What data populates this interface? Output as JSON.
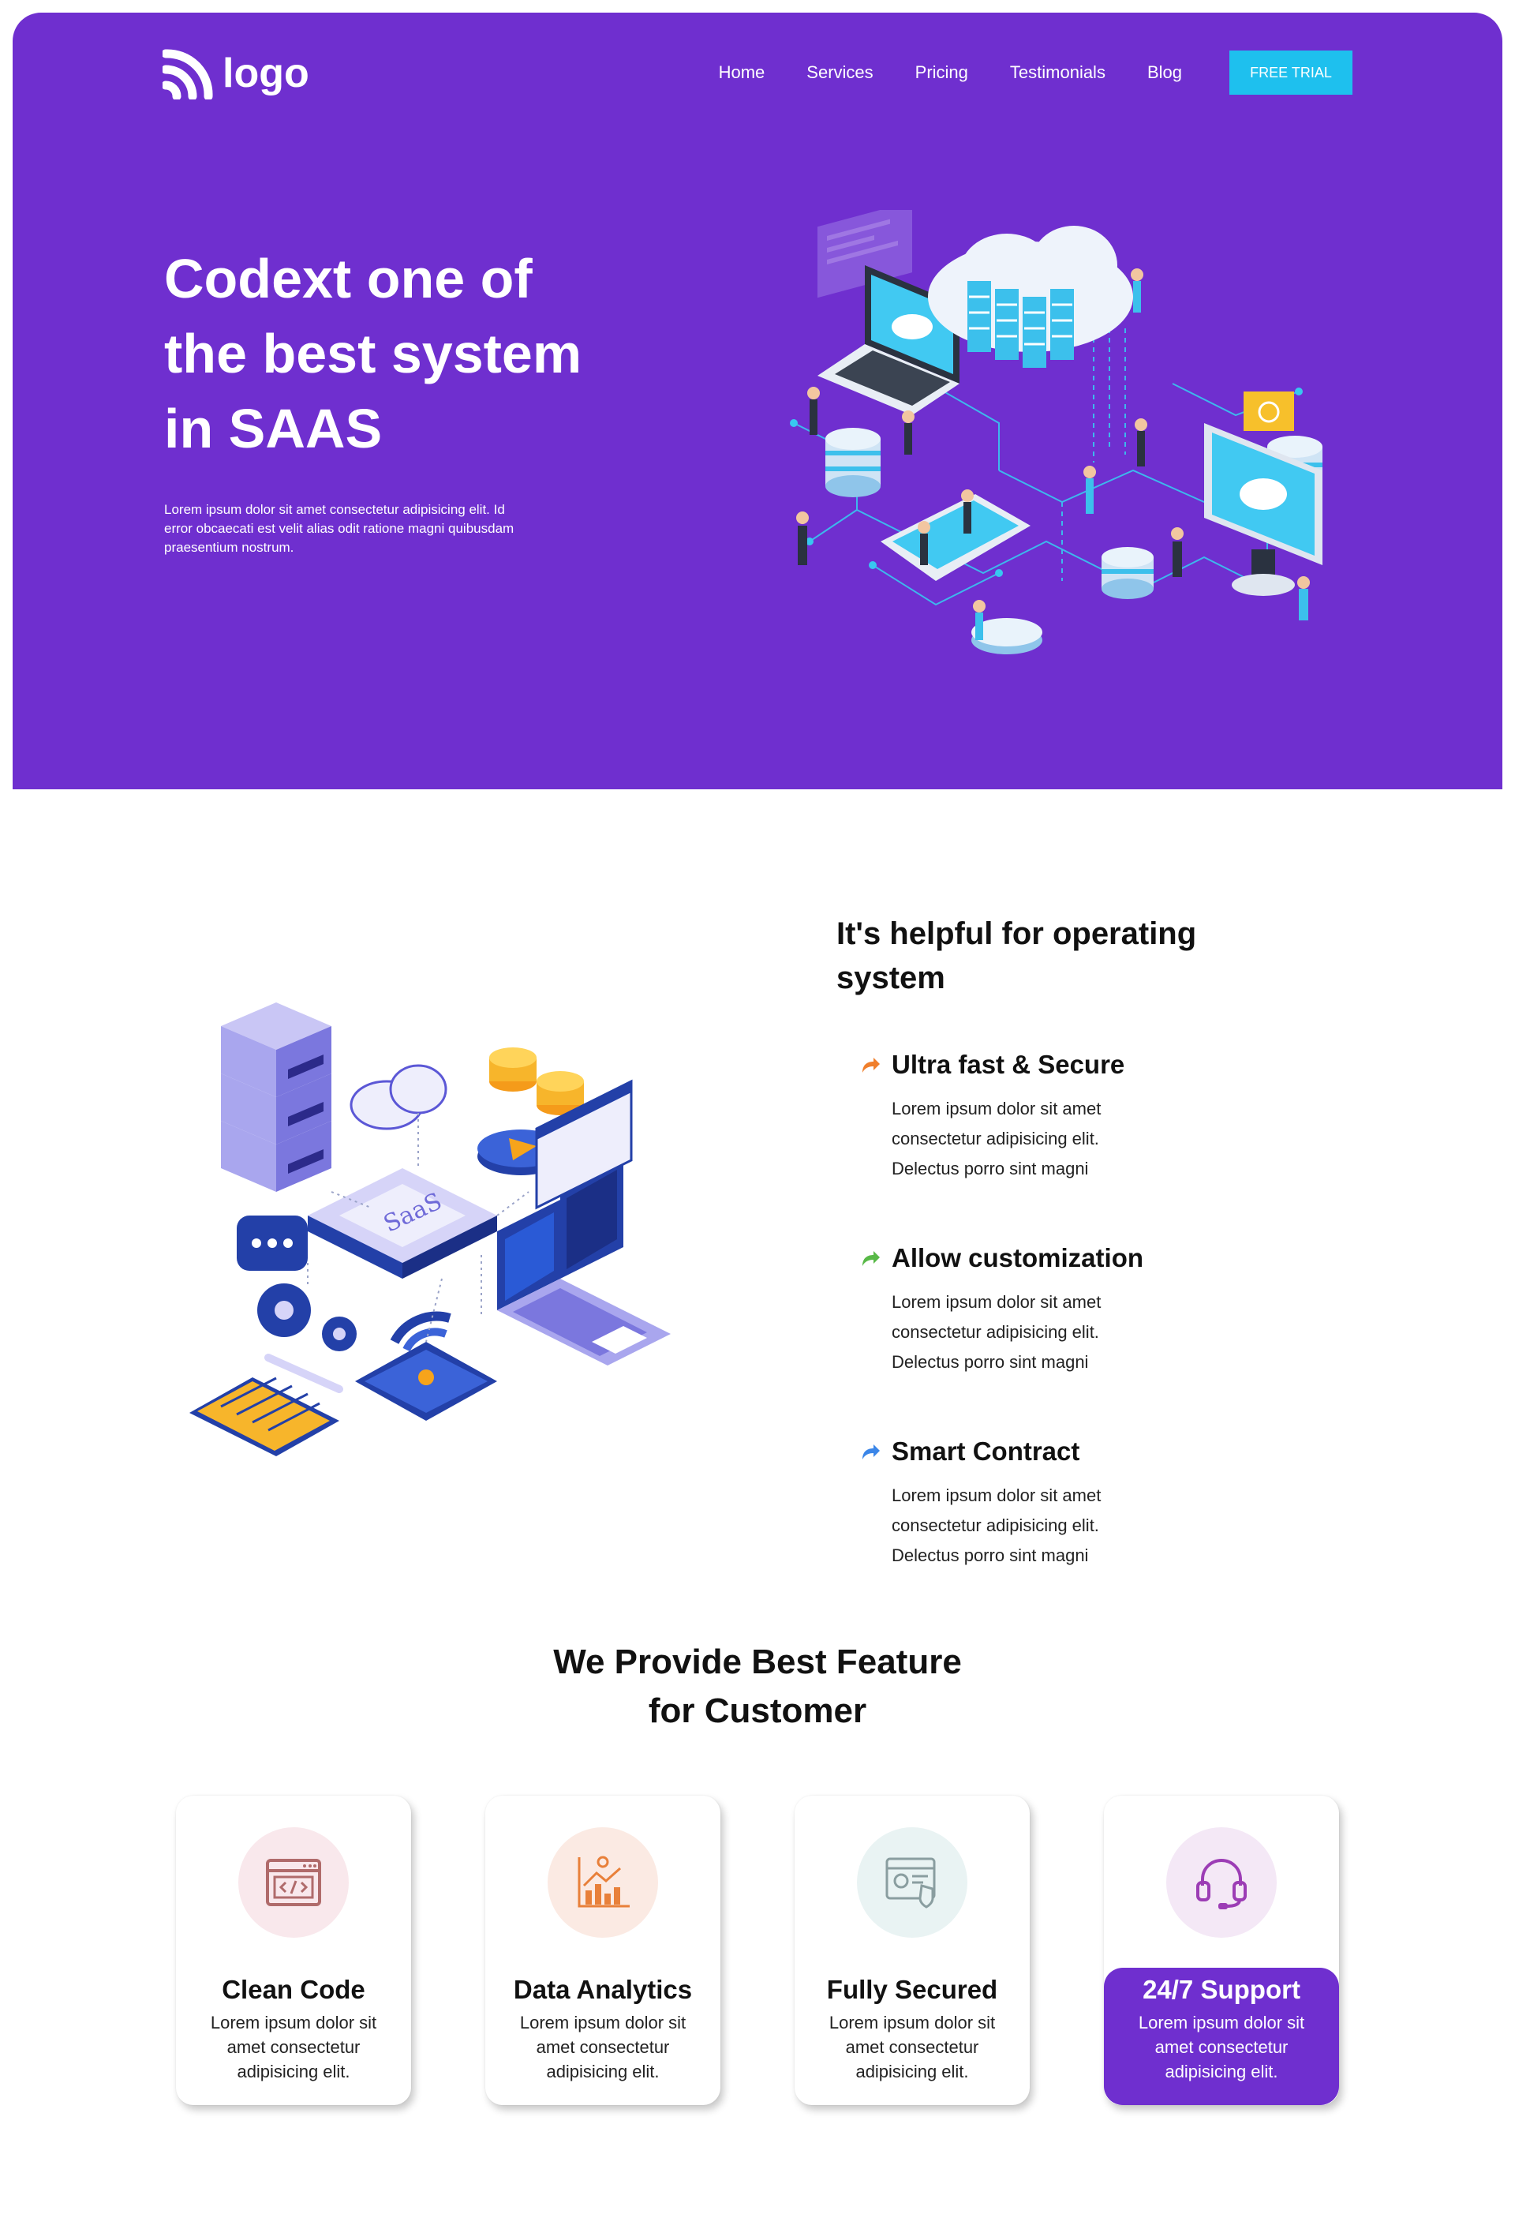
{
  "nav": {
    "logo_text": "logo",
    "items": [
      "Home",
      "Services",
      "Pricing",
      "Testimonials",
      "Blog"
    ],
    "cta": "FREE TRIAL"
  },
  "hero": {
    "title_line1": "Codext one of",
    "title_line2": "the best system",
    "title_line3": "in SAAS",
    "text": "Lorem ipsum dolor sit amet consectetur adipisicing elit. Id error obcaecati est velit alias odit ratione magni quibusdam praesentium nostrum."
  },
  "section2": {
    "title": "It's helpful for operating system",
    "illustration_label": "SaaS",
    "features": [
      {
        "title": "Ultra fast & Secure",
        "text": "Lorem ipsum dolor sit amet consectetur adipisicing elit. Delectus porro sint magni",
        "arrow_color": "#f07f2c"
      },
      {
        "title": "Allow customization",
        "text": "Lorem ipsum dolor sit amet consectetur adipisicing elit. Delectus porro sint magni",
        "arrow_color": "#58b947"
      },
      {
        "title": "Smart Contract",
        "text": "Lorem ipsum dolor sit amet consectetur adipisicing elit. Delectus porro sint magni",
        "arrow_color": "#3b86e8"
      }
    ]
  },
  "section3": {
    "title_line1": "We Provide Best Feature",
    "title_line2": "for Customer",
    "cards": [
      {
        "title": "Clean Code",
        "text": "Lorem ipsum dolor sit amet consectetur adipisicing elit.",
        "icon": "code-window-icon",
        "bg": "#f9e8ec",
        "color": "#b06b6b"
      },
      {
        "title": "Data Analytics",
        "text": "Lorem ipsum dolor sit amet consectetur adipisicing elit.",
        "icon": "analytics-chart-icon",
        "bg": "#fbeae3",
        "color": "#e8803a"
      },
      {
        "title": "Fully Secured",
        "text": "Lorem ipsum dolor sit amet consectetur adipisicing elit.",
        "icon": "secure-shield-icon",
        "bg": "#e9f3f3",
        "color": "#8a9ea0"
      },
      {
        "title": "24/7 Support",
        "text": "Lorem ipsum dolor sit amet consectetur adipisicing elit.",
        "icon": "headset-icon",
        "bg": "#f4e8f6",
        "color": "#9c3db5"
      }
    ]
  },
  "colors": {
    "brand": "#6f2fcf",
    "cta": "#1ec0ee"
  }
}
